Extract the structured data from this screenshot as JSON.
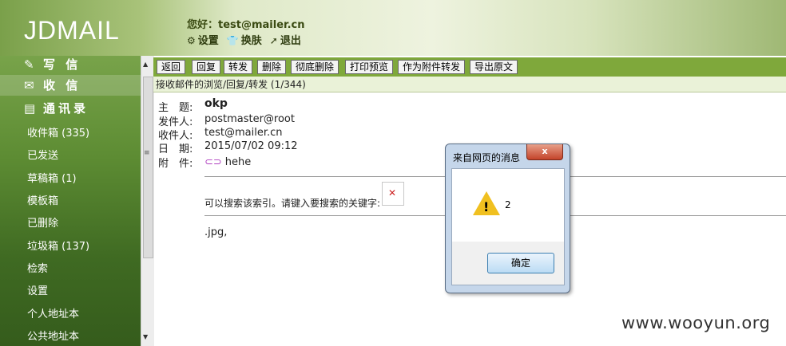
{
  "header": {
    "logo": "JDMAIL",
    "greeting": "您好：test@mailer.cn",
    "links": [
      {
        "icon": "gear-icon",
        "label": "设置"
      },
      {
        "icon": "shirt-icon",
        "label": "换肤"
      },
      {
        "icon": "exit-arrow-icon",
        "label": "退出"
      }
    ]
  },
  "sidebar": {
    "top_items": [
      "写 信",
      "收 信",
      "通讯录"
    ],
    "folders": [
      "收件箱 (335)",
      "已发送",
      "草稿箱 (1)",
      "模板箱",
      "已删除",
      "垃圾箱 (137)",
      "检索",
      "设置",
      "个人地址本",
      "公共地址本"
    ]
  },
  "toolbar": {
    "buttons": [
      "返回",
      "回复",
      "转发",
      "删除",
      "彻底删除",
      "打印预览",
      "作为附件转发",
      "导出原文"
    ],
    "subtitle": "接收邮件的浏览/回复/转发 (1/344)"
  },
  "mail": {
    "labels": {
      "subject": "主　题:",
      "from": "发件人:",
      "to": "收件人:",
      "date": "日　期:",
      "attachment": "附　件:"
    },
    "subject": "okp",
    "from": "postmaster@root",
    "to": "test@mailer.cn",
    "date": "2015/07/02 09:12",
    "attachment": "hehe",
    "body_line1": "可以搜索该索引。请键入要搜索的关键字:",
    "body_line2": ".jpg,"
  },
  "dialog": {
    "title": "来自网页的消息",
    "message": "2",
    "ok_label": "确定",
    "close_label": "x"
  },
  "watermark": "www.wooyun.org"
}
